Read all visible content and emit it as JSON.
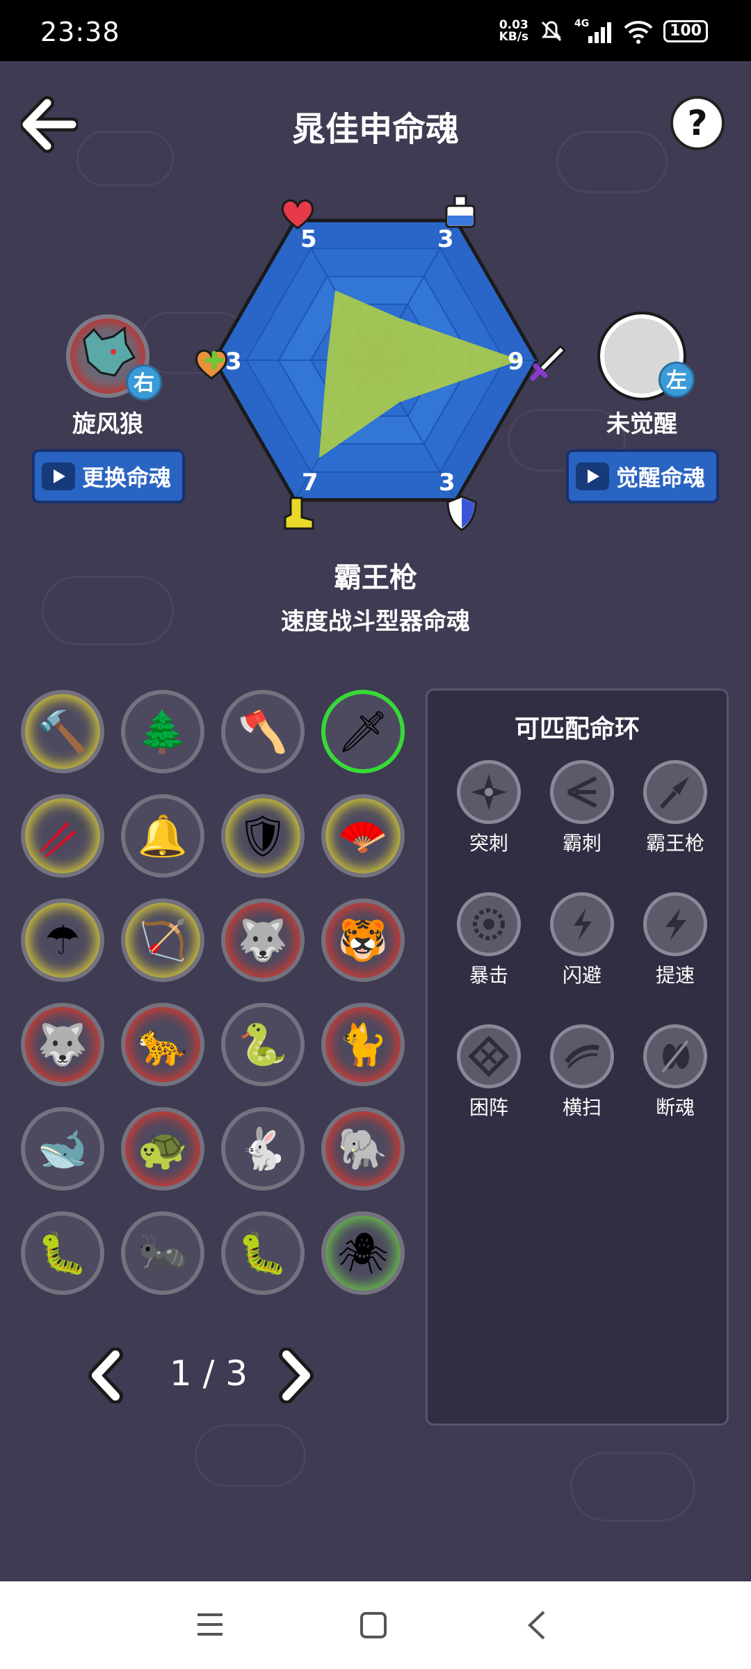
{
  "status_bar": {
    "time": "23:38",
    "net_speed_value": "0.03",
    "net_speed_unit": "KB/s",
    "network": "4G",
    "battery": "100"
  },
  "header": {
    "title": "晁佳申命魂"
  },
  "stats": {
    "hp": "5",
    "mp": "3",
    "attack": "9",
    "defense": "3",
    "speed": "7",
    "heal": "3"
  },
  "chart_data": {
    "type": "radar",
    "axes": [
      "hp",
      "mp",
      "attack",
      "defense",
      "speed",
      "heal"
    ],
    "values": [
      5,
      3,
      9,
      3,
      7,
      3
    ],
    "max": 10
  },
  "left_soul": {
    "name": "旋风狼",
    "tag": "右",
    "button_label": "更换命魂"
  },
  "right_soul": {
    "name": "未觉醒",
    "tag": "左",
    "button_label": "觉醒命魂"
  },
  "weapon": {
    "name": "霸王枪",
    "type": "速度战斗型器命魂"
  },
  "pager": {
    "text": "1 / 3"
  },
  "panel": {
    "title": "可匹配命环",
    "rings": [
      {
        "label": "突刺"
      },
      {
        "label": "霸刺"
      },
      {
        "label": "霸王枪"
      },
      {
        "label": "暴击"
      },
      {
        "label": "闪避"
      },
      {
        "label": "提速"
      },
      {
        "label": "困阵"
      },
      {
        "label": "横扫"
      },
      {
        "label": "断魂"
      }
    ]
  },
  "colors": {
    "background": "#3e3b52",
    "radar_fill": "#2d6dd0",
    "radar_value": "#b5d43f",
    "button_blue": "#2a64c2",
    "selected_ring": "#38d838"
  }
}
